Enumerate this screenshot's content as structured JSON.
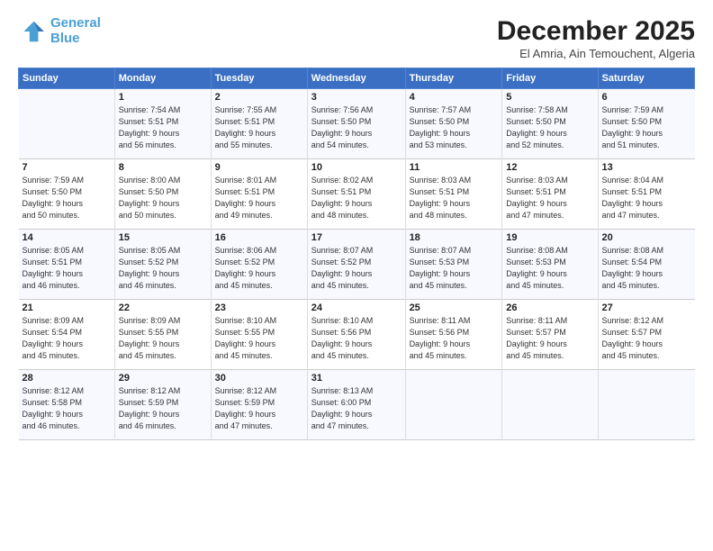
{
  "header": {
    "logo_line1": "General",
    "logo_line2": "Blue",
    "month_title": "December 2025",
    "subtitle": "El Amria, Ain Temouchent, Algeria"
  },
  "weekdays": [
    "Sunday",
    "Monday",
    "Tuesday",
    "Wednesday",
    "Thursday",
    "Friday",
    "Saturday"
  ],
  "weeks": [
    [
      {
        "day": "",
        "info": ""
      },
      {
        "day": "1",
        "info": "Sunrise: 7:54 AM\nSunset: 5:51 PM\nDaylight: 9 hours\nand 56 minutes."
      },
      {
        "day": "2",
        "info": "Sunrise: 7:55 AM\nSunset: 5:51 PM\nDaylight: 9 hours\nand 55 minutes."
      },
      {
        "day": "3",
        "info": "Sunrise: 7:56 AM\nSunset: 5:50 PM\nDaylight: 9 hours\nand 54 minutes."
      },
      {
        "day": "4",
        "info": "Sunrise: 7:57 AM\nSunset: 5:50 PM\nDaylight: 9 hours\nand 53 minutes."
      },
      {
        "day": "5",
        "info": "Sunrise: 7:58 AM\nSunset: 5:50 PM\nDaylight: 9 hours\nand 52 minutes."
      },
      {
        "day": "6",
        "info": "Sunrise: 7:59 AM\nSunset: 5:50 PM\nDaylight: 9 hours\nand 51 minutes."
      }
    ],
    [
      {
        "day": "7",
        "info": "Sunrise: 7:59 AM\nSunset: 5:50 PM\nDaylight: 9 hours\nand 50 minutes."
      },
      {
        "day": "8",
        "info": "Sunrise: 8:00 AM\nSunset: 5:50 PM\nDaylight: 9 hours\nand 50 minutes."
      },
      {
        "day": "9",
        "info": "Sunrise: 8:01 AM\nSunset: 5:51 PM\nDaylight: 9 hours\nand 49 minutes."
      },
      {
        "day": "10",
        "info": "Sunrise: 8:02 AM\nSunset: 5:51 PM\nDaylight: 9 hours\nand 48 minutes."
      },
      {
        "day": "11",
        "info": "Sunrise: 8:03 AM\nSunset: 5:51 PM\nDaylight: 9 hours\nand 48 minutes."
      },
      {
        "day": "12",
        "info": "Sunrise: 8:03 AM\nSunset: 5:51 PM\nDaylight: 9 hours\nand 47 minutes."
      },
      {
        "day": "13",
        "info": "Sunrise: 8:04 AM\nSunset: 5:51 PM\nDaylight: 9 hours\nand 47 minutes."
      }
    ],
    [
      {
        "day": "14",
        "info": "Sunrise: 8:05 AM\nSunset: 5:51 PM\nDaylight: 9 hours\nand 46 minutes."
      },
      {
        "day": "15",
        "info": "Sunrise: 8:05 AM\nSunset: 5:52 PM\nDaylight: 9 hours\nand 46 minutes."
      },
      {
        "day": "16",
        "info": "Sunrise: 8:06 AM\nSunset: 5:52 PM\nDaylight: 9 hours\nand 45 minutes."
      },
      {
        "day": "17",
        "info": "Sunrise: 8:07 AM\nSunset: 5:52 PM\nDaylight: 9 hours\nand 45 minutes."
      },
      {
        "day": "18",
        "info": "Sunrise: 8:07 AM\nSunset: 5:53 PM\nDaylight: 9 hours\nand 45 minutes."
      },
      {
        "day": "19",
        "info": "Sunrise: 8:08 AM\nSunset: 5:53 PM\nDaylight: 9 hours\nand 45 minutes."
      },
      {
        "day": "20",
        "info": "Sunrise: 8:08 AM\nSunset: 5:54 PM\nDaylight: 9 hours\nand 45 minutes."
      }
    ],
    [
      {
        "day": "21",
        "info": "Sunrise: 8:09 AM\nSunset: 5:54 PM\nDaylight: 9 hours\nand 45 minutes."
      },
      {
        "day": "22",
        "info": "Sunrise: 8:09 AM\nSunset: 5:55 PM\nDaylight: 9 hours\nand 45 minutes."
      },
      {
        "day": "23",
        "info": "Sunrise: 8:10 AM\nSunset: 5:55 PM\nDaylight: 9 hours\nand 45 minutes."
      },
      {
        "day": "24",
        "info": "Sunrise: 8:10 AM\nSunset: 5:56 PM\nDaylight: 9 hours\nand 45 minutes."
      },
      {
        "day": "25",
        "info": "Sunrise: 8:11 AM\nSunset: 5:56 PM\nDaylight: 9 hours\nand 45 minutes."
      },
      {
        "day": "26",
        "info": "Sunrise: 8:11 AM\nSunset: 5:57 PM\nDaylight: 9 hours\nand 45 minutes."
      },
      {
        "day": "27",
        "info": "Sunrise: 8:12 AM\nSunset: 5:57 PM\nDaylight: 9 hours\nand 45 minutes."
      }
    ],
    [
      {
        "day": "28",
        "info": "Sunrise: 8:12 AM\nSunset: 5:58 PM\nDaylight: 9 hours\nand 46 minutes."
      },
      {
        "day": "29",
        "info": "Sunrise: 8:12 AM\nSunset: 5:59 PM\nDaylight: 9 hours\nand 46 minutes."
      },
      {
        "day": "30",
        "info": "Sunrise: 8:12 AM\nSunset: 5:59 PM\nDaylight: 9 hours\nand 47 minutes."
      },
      {
        "day": "31",
        "info": "Sunrise: 8:13 AM\nSunset: 6:00 PM\nDaylight: 9 hours\nand 47 minutes."
      },
      {
        "day": "",
        "info": ""
      },
      {
        "day": "",
        "info": ""
      },
      {
        "day": "",
        "info": ""
      }
    ]
  ]
}
